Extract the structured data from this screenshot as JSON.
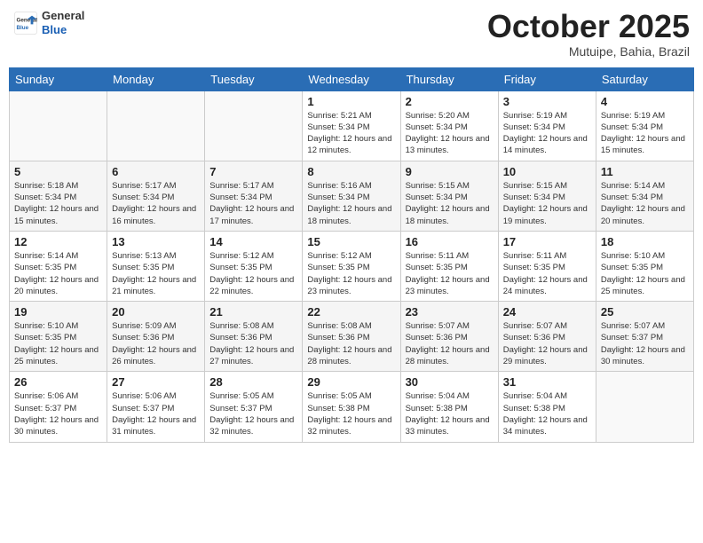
{
  "logo": {
    "line1": "General",
    "line2": "Blue"
  },
  "header": {
    "month": "October 2025",
    "location": "Mutuipe, Bahia, Brazil"
  },
  "weekdays": [
    "Sunday",
    "Monday",
    "Tuesday",
    "Wednesday",
    "Thursday",
    "Friday",
    "Saturday"
  ],
  "weeks": [
    [
      {
        "day": "",
        "info": ""
      },
      {
        "day": "",
        "info": ""
      },
      {
        "day": "",
        "info": ""
      },
      {
        "day": "1",
        "info": "Sunrise: 5:21 AM\nSunset: 5:34 PM\nDaylight: 12 hours\nand 12 minutes."
      },
      {
        "day": "2",
        "info": "Sunrise: 5:20 AM\nSunset: 5:34 PM\nDaylight: 12 hours\nand 13 minutes."
      },
      {
        "day": "3",
        "info": "Sunrise: 5:19 AM\nSunset: 5:34 PM\nDaylight: 12 hours\nand 14 minutes."
      },
      {
        "day": "4",
        "info": "Sunrise: 5:19 AM\nSunset: 5:34 PM\nDaylight: 12 hours\nand 15 minutes."
      }
    ],
    [
      {
        "day": "5",
        "info": "Sunrise: 5:18 AM\nSunset: 5:34 PM\nDaylight: 12 hours\nand 15 minutes."
      },
      {
        "day": "6",
        "info": "Sunrise: 5:17 AM\nSunset: 5:34 PM\nDaylight: 12 hours\nand 16 minutes."
      },
      {
        "day": "7",
        "info": "Sunrise: 5:17 AM\nSunset: 5:34 PM\nDaylight: 12 hours\nand 17 minutes."
      },
      {
        "day": "8",
        "info": "Sunrise: 5:16 AM\nSunset: 5:34 PM\nDaylight: 12 hours\nand 18 minutes."
      },
      {
        "day": "9",
        "info": "Sunrise: 5:15 AM\nSunset: 5:34 PM\nDaylight: 12 hours\nand 18 minutes."
      },
      {
        "day": "10",
        "info": "Sunrise: 5:15 AM\nSunset: 5:34 PM\nDaylight: 12 hours\nand 19 minutes."
      },
      {
        "day": "11",
        "info": "Sunrise: 5:14 AM\nSunset: 5:34 PM\nDaylight: 12 hours\nand 20 minutes."
      }
    ],
    [
      {
        "day": "12",
        "info": "Sunrise: 5:14 AM\nSunset: 5:35 PM\nDaylight: 12 hours\nand 20 minutes."
      },
      {
        "day": "13",
        "info": "Sunrise: 5:13 AM\nSunset: 5:35 PM\nDaylight: 12 hours\nand 21 minutes."
      },
      {
        "day": "14",
        "info": "Sunrise: 5:12 AM\nSunset: 5:35 PM\nDaylight: 12 hours\nand 22 minutes."
      },
      {
        "day": "15",
        "info": "Sunrise: 5:12 AM\nSunset: 5:35 PM\nDaylight: 12 hours\nand 23 minutes."
      },
      {
        "day": "16",
        "info": "Sunrise: 5:11 AM\nSunset: 5:35 PM\nDaylight: 12 hours\nand 23 minutes."
      },
      {
        "day": "17",
        "info": "Sunrise: 5:11 AM\nSunset: 5:35 PM\nDaylight: 12 hours\nand 24 minutes."
      },
      {
        "day": "18",
        "info": "Sunrise: 5:10 AM\nSunset: 5:35 PM\nDaylight: 12 hours\nand 25 minutes."
      }
    ],
    [
      {
        "day": "19",
        "info": "Sunrise: 5:10 AM\nSunset: 5:35 PM\nDaylight: 12 hours\nand 25 minutes."
      },
      {
        "day": "20",
        "info": "Sunrise: 5:09 AM\nSunset: 5:36 PM\nDaylight: 12 hours\nand 26 minutes."
      },
      {
        "day": "21",
        "info": "Sunrise: 5:08 AM\nSunset: 5:36 PM\nDaylight: 12 hours\nand 27 minutes."
      },
      {
        "day": "22",
        "info": "Sunrise: 5:08 AM\nSunset: 5:36 PM\nDaylight: 12 hours\nand 28 minutes."
      },
      {
        "day": "23",
        "info": "Sunrise: 5:07 AM\nSunset: 5:36 PM\nDaylight: 12 hours\nand 28 minutes."
      },
      {
        "day": "24",
        "info": "Sunrise: 5:07 AM\nSunset: 5:36 PM\nDaylight: 12 hours\nand 29 minutes."
      },
      {
        "day": "25",
        "info": "Sunrise: 5:07 AM\nSunset: 5:37 PM\nDaylight: 12 hours\nand 30 minutes."
      }
    ],
    [
      {
        "day": "26",
        "info": "Sunrise: 5:06 AM\nSunset: 5:37 PM\nDaylight: 12 hours\nand 30 minutes."
      },
      {
        "day": "27",
        "info": "Sunrise: 5:06 AM\nSunset: 5:37 PM\nDaylight: 12 hours\nand 31 minutes."
      },
      {
        "day": "28",
        "info": "Sunrise: 5:05 AM\nSunset: 5:37 PM\nDaylight: 12 hours\nand 32 minutes."
      },
      {
        "day": "29",
        "info": "Sunrise: 5:05 AM\nSunset: 5:38 PM\nDaylight: 12 hours\nand 32 minutes."
      },
      {
        "day": "30",
        "info": "Sunrise: 5:04 AM\nSunset: 5:38 PM\nDaylight: 12 hours\nand 33 minutes."
      },
      {
        "day": "31",
        "info": "Sunrise: 5:04 AM\nSunset: 5:38 PM\nDaylight: 12 hours\nand 34 minutes."
      },
      {
        "day": "",
        "info": ""
      }
    ]
  ]
}
